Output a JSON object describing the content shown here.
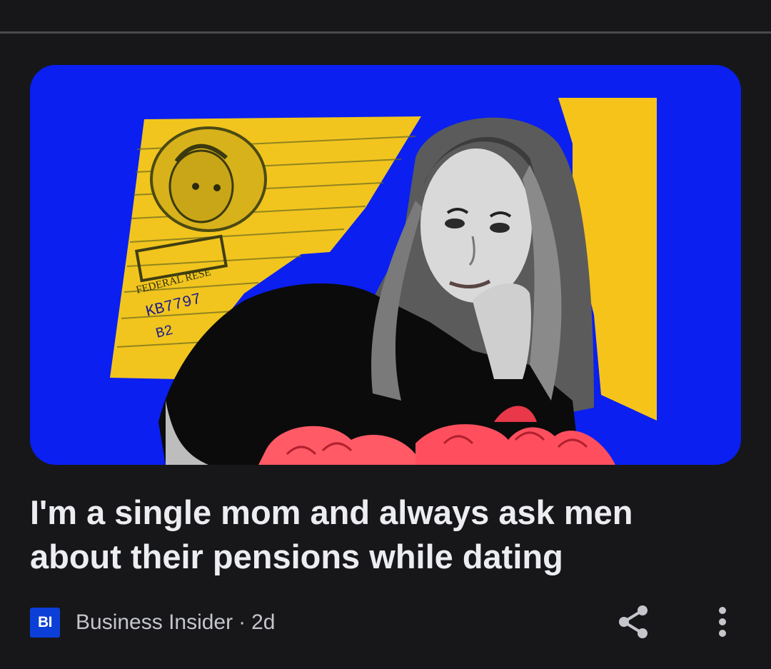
{
  "article": {
    "headline": "I'm a single mom and always ask men about their pensions while dating",
    "source": "Business Insider",
    "separator": "·",
    "age": "2d",
    "logo_text": "BI",
    "thumbnail": {
      "bill_text": {
        "serial": "KB7797",
        "block": "B2",
        "bank": "FEDERAL RESE"
      }
    }
  },
  "icons": {
    "share": "share-icon",
    "more": "more-vert-icon"
  },
  "colors": {
    "background": "#17171a",
    "thumb_bg": "#0a1ff0",
    "accent_yellow": "#f6c31b",
    "logo_bg": "#0b3fd8"
  }
}
